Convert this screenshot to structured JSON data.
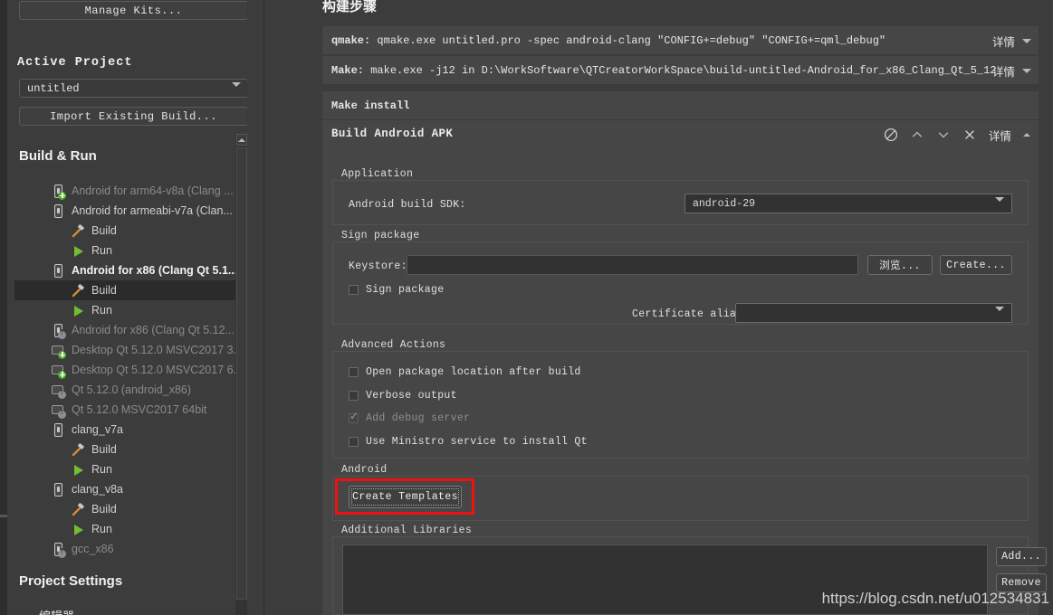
{
  "sidebar": {
    "manage_kits_button": "Manage Kits...",
    "active_project_heading": "Active Project",
    "project_combo_value": "untitled",
    "import_existing_build_button": "Import Existing Build...",
    "build_and_run_heading": "Build & Run",
    "project_settings_heading": "Project Settings",
    "project_settings_first_item": "编辑器",
    "tree": [
      {
        "label": "Android for arm64-v8a (Clang ...",
        "icon": "device-add-icon",
        "style": "dim",
        "indent": 40
      },
      {
        "label": "Android for armeabi-v7a (Clan...",
        "icon": "device-icon",
        "style": "normal",
        "indent": 40
      },
      {
        "label": "Build",
        "icon": "hammer-icon",
        "style": "normal",
        "indent": 62
      },
      {
        "label": "Run",
        "icon": "run-icon",
        "style": "normal",
        "indent": 62
      },
      {
        "label": "Android for x86 (Clang Qt 5.1...",
        "icon": "device-icon",
        "style": "bold",
        "indent": 40
      },
      {
        "label": "Build",
        "icon": "hammer-icon",
        "style": "selected",
        "indent": 62
      },
      {
        "label": "Run",
        "icon": "run-icon",
        "style": "normal",
        "indent": 62
      },
      {
        "label": "Android for x86 (Clang Qt 5.12....",
        "icon": "device-warn-icon",
        "style": "dim",
        "indent": 40
      },
      {
        "label": "Desktop Qt 5.12.0 MSVC2017 3...",
        "icon": "desktop-add-icon",
        "style": "dim",
        "indent": 40
      },
      {
        "label": "Desktop Qt 5.12.0 MSVC2017 6...",
        "icon": "desktop-add-icon",
        "style": "dim",
        "indent": 40
      },
      {
        "label": "Qt 5.12.0 (android_x86)",
        "icon": "desktop-warn-icon",
        "style": "dim",
        "indent": 40
      },
      {
        "label": "Qt 5.12.0 MSVC2017 64bit",
        "icon": "desktop-warn-icon",
        "style": "dim",
        "indent": 40
      },
      {
        "label": "clang_v7a",
        "icon": "device-icon",
        "style": "normal",
        "indent": 40
      },
      {
        "label": "Build",
        "icon": "hammer-icon",
        "style": "normal",
        "indent": 62
      },
      {
        "label": "Run",
        "icon": "run-icon",
        "style": "normal",
        "indent": 62
      },
      {
        "label": "clang_v8a",
        "icon": "device-icon",
        "style": "normal",
        "indent": 40
      },
      {
        "label": "Build",
        "icon": "hammer-icon",
        "style": "normal",
        "indent": 62
      },
      {
        "label": "Run",
        "icon": "run-icon",
        "style": "normal",
        "indent": 62
      },
      {
        "label": "gcc_x86",
        "icon": "device-warn-icon",
        "style": "dim",
        "indent": 40
      }
    ]
  },
  "main": {
    "page_heading": "构建步骤",
    "detail_label": "详情",
    "steps": [
      {
        "name": "qmake:",
        "command": "qmake.exe untitled.pro -spec android-clang \"CONFIG+=debug\" \"CONFIG+=qml_debug\"",
        "has_detail": true
      },
      {
        "name": "Make:",
        "command": "make.exe -j12 in D:\\WorkSoftware\\QTCreatorWorkSpace\\build-untitled-Android_for_x86_Clang_Qt_5_12",
        "has_detail": true
      },
      {
        "name": "Make install",
        "command": "",
        "has_detail": false
      }
    ],
    "apk": {
      "title": "Build Android APK",
      "tools": [
        "disable-icon",
        "move-up-icon",
        "move-down-icon",
        "remove-icon"
      ],
      "detail_label": "详情",
      "application_group": "Application",
      "android_build_sdk_label": "Android build SDK:",
      "android_build_sdk_value": "android-29",
      "sign_package_group": "Sign package",
      "keystore_label": "Keystore:",
      "keystore_value": "",
      "browse_button": "浏览...",
      "create_button": "Create...",
      "sign_package_checkbox": "Sign package",
      "certificate_alias_label": "Certificate alias:",
      "certificate_alias_value": "",
      "advanced_actions_group": "Advanced Actions",
      "advanced_checkboxes": [
        {
          "label": "Open package location after build",
          "checked": false,
          "disabled": false
        },
        {
          "label": "Verbose output",
          "checked": false,
          "disabled": false
        },
        {
          "label": "Add debug server",
          "checked": true,
          "disabled": true
        },
        {
          "label": "Use Ministro service to install Qt",
          "checked": false,
          "disabled": false
        }
      ],
      "android_group": "Android",
      "create_templates_button": "Create Templates",
      "additional_libraries_group": "Additional Libraries",
      "add_button": "Add...",
      "remove_button": "Remove"
    }
  },
  "watermark": "https://blog.csdn.net/u012534831",
  "colors": {
    "window_bg": "#3c3c3c",
    "panel_bg": "#464646",
    "field_bg": "#323232",
    "selection_bg": "#2b2b2b",
    "text": "#e4e4e4",
    "text_dim": "#8a8a8a",
    "accent_green": "#6fbf2f",
    "highlight_red": "#f01010"
  }
}
